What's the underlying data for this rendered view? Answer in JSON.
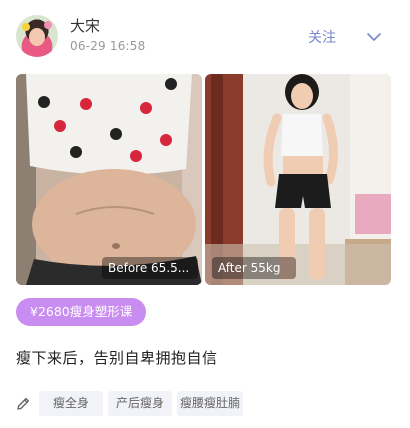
{
  "post": {
    "author": "大宋",
    "timestamp": "06-29 16:58",
    "follow_label": "关注",
    "photos": [
      {
        "caption": "Before 65.5..."
      },
      {
        "caption": "After 55kg"
      }
    ],
    "course_tag": "¥2680瘦身塑形课",
    "text": "瘦下来后，告别自卑拥抱自信",
    "topic_tags": [
      "瘦全身",
      "产后瘦身",
      "瘦腰瘦肚腩"
    ]
  },
  "colors": {
    "accent": "#7a86c9",
    "course_tag_bg": "#c98cf0",
    "tag_bg": "#f1f3f8"
  },
  "icons": {
    "more": "chevron-down-icon",
    "edit": "pencil-icon"
  }
}
